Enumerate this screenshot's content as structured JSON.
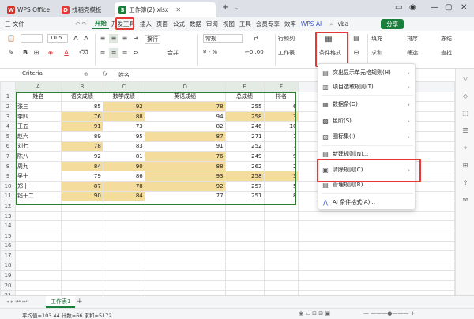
{
  "titlebar": {
    "tabs": [
      {
        "label": "WPS Office",
        "icon": "wps-icon"
      },
      {
        "label": "找稻壳模板",
        "icon": "docer-icon"
      },
      {
        "label": "工作簿(2).xlsx",
        "icon": "sheet-icon"
      }
    ]
  },
  "menubar": {
    "file": "三 文件",
    "items": [
      "开始",
      "开发工具",
      "插入",
      "页面",
      "公式",
      "数据",
      "审阅",
      "视图",
      "工具",
      "会员专享",
      "效率",
      "WPS AI"
    ],
    "search": "vba",
    "share": "分享"
  },
  "ribbon": {
    "font_size": "10.5",
    "number_format": "常规",
    "wrap": "换行",
    "merge": "合并",
    "rowcol": "行和列",
    "worksheet": "工作表",
    "cond_format": "条件格式",
    "fill": "填充",
    "sort": "排序",
    "freeze": "冻结",
    "sum": "求和",
    "filter": "筛选",
    "find": "查找"
  },
  "formula": {
    "namebox": "Criteria",
    "fx": "fx",
    "value": "姓名"
  },
  "grid": {
    "columns": [
      "A",
      "B",
      "C",
      "D",
      "E",
      "F"
    ],
    "rows": [
      [
        "姓名",
        "语文成绩",
        "数学成绩",
        "英语成绩",
        "总成绩",
        "排名"
      ],
      [
        "张三",
        "85",
        "92",
        "78",
        "255",
        "6"
      ],
      [
        "李四",
        "76",
        "88",
        "94",
        "258",
        "3"
      ],
      [
        "王五",
        "91",
        "73",
        "82",
        "246",
        "10"
      ],
      [
        "赵六",
        "89",
        "95",
        "87",
        "271",
        "1"
      ],
      [
        "刘七",
        "78",
        "83",
        "91",
        "252",
        "7"
      ],
      [
        "陈八",
        "92",
        "81",
        "76",
        "249",
        "9"
      ],
      [
        "周九",
        "84",
        "90",
        "88",
        "262",
        "2"
      ],
      [
        "吴十",
        "79",
        "86",
        "93",
        "258",
        "3"
      ],
      [
        "郑十一",
        "87",
        "78",
        "92",
        "257",
        "5"
      ],
      [
        "钱十二",
        "90",
        "84",
        "77",
        "251",
        "8"
      ]
    ],
    "extra_rows": [
      "12",
      "13",
      "14",
      "15",
      "16",
      "17",
      "18",
      "19",
      "20",
      "21"
    ]
  },
  "dropdown": {
    "items": [
      "突出显示单元格规则(H)",
      "项目选取规则(T)",
      "数据条(D)",
      "色阶(S)",
      "图标集(I)",
      "新建规则(N)...",
      "清除规则(C)",
      "管理规则(R)...",
      "AI 条件格式(A)..."
    ]
  },
  "sheet": {
    "tab": "工作表1"
  },
  "status": {
    "text": "平均值=103.44  计数=66  求和=5172"
  },
  "colors": {
    "accent": "#1a7f3c",
    "highlight": "#f4dc9c",
    "annotation": "#e53935"
  }
}
